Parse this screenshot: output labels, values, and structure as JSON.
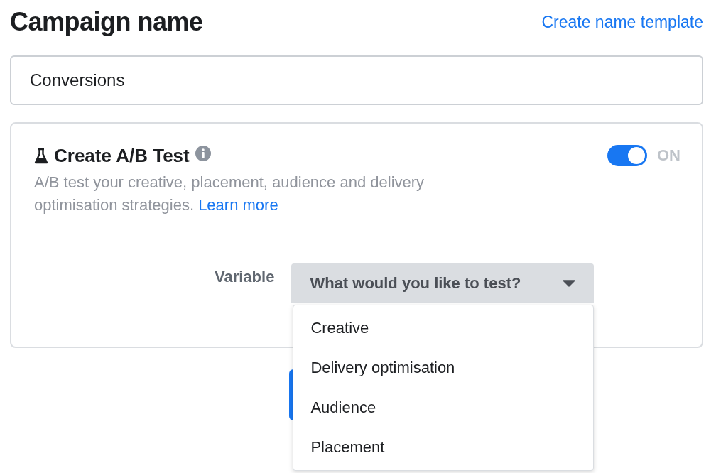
{
  "header": {
    "title": "Campaign name",
    "link": "Create name template"
  },
  "name_field": {
    "value": "Conversions"
  },
  "ab_test": {
    "title": "Create A/B Test",
    "toggle": {
      "on": true,
      "label": "ON"
    },
    "description": "A/B test your creative, placement, audience and delivery optimisation strategies.",
    "learn_more": "Learn more",
    "variable": {
      "label": "Variable",
      "placeholder": "What would you like to test?",
      "expanded": true,
      "options": [
        {
          "label": "Creative"
        },
        {
          "label": "Delivery optimisation"
        },
        {
          "label": "Audience"
        },
        {
          "label": "Placement"
        }
      ]
    }
  }
}
